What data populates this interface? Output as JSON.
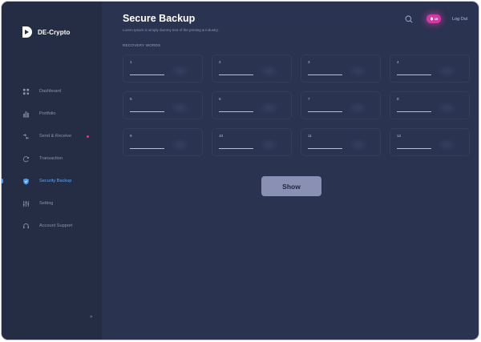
{
  "brand": {
    "name": "DE-Crypto"
  },
  "sidebar": {
    "items": [
      {
        "label": "Dashboard",
        "icon": "dashboard-icon"
      },
      {
        "label": "Portfolio",
        "icon": "chart-icon"
      },
      {
        "label": "Send & Receive",
        "icon": "transfer-icon"
      },
      {
        "label": "Transaction",
        "icon": "refresh-icon"
      },
      {
        "label": "Security Backup",
        "icon": "shield-icon"
      },
      {
        "label": "Setting",
        "icon": "sliders-icon"
      },
      {
        "label": "Account Support",
        "icon": "headset-icon"
      }
    ],
    "active_index": 4,
    "collapse_label": "»"
  },
  "header": {
    "title": "Secure Backup",
    "subtitle": "Lorem Ipsum is simply dummy text of the printing & industry.",
    "notifications": "15",
    "logout_label": "Log Out"
  },
  "section": {
    "label": "RECOVERY WORDS"
  },
  "words": [
    {
      "num": "1"
    },
    {
      "num": "2"
    },
    {
      "num": "3"
    },
    {
      "num": "4"
    },
    {
      "num": "5"
    },
    {
      "num": "6"
    },
    {
      "num": "7"
    },
    {
      "num": "8"
    },
    {
      "num": "9"
    },
    {
      "num": "10"
    },
    {
      "num": "11"
    },
    {
      "num": "12"
    }
  ],
  "actions": {
    "show_label": "Show"
  },
  "colors": {
    "background": "#2a3350",
    "sidebar": "#252d45",
    "accent": "#4d9bff",
    "badge": "#d03aa6",
    "button": "#8990b4"
  }
}
